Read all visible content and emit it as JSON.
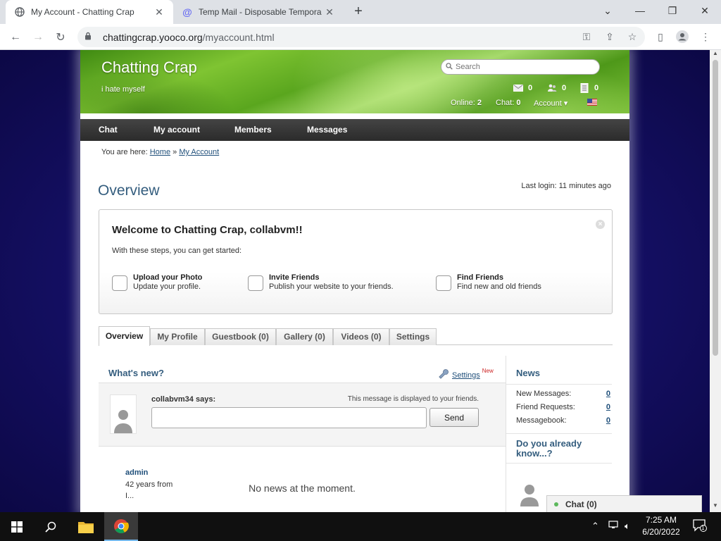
{
  "browser": {
    "tabs": [
      {
        "title": "My Account - Chatting Crap",
        "active": true
      },
      {
        "title": "Temp Mail - Disposable Tempora",
        "active": false
      }
    ],
    "url_host": "chattingcrap.yooco.org",
    "url_path": "/myaccount.html"
  },
  "site": {
    "name": "Chatting Crap",
    "tagline": "i hate myself",
    "search_placeholder": "Search",
    "counters": {
      "messages": "0",
      "friends": "0",
      "guestbook": "0"
    },
    "online_label": "Online:",
    "online_count": "2",
    "chat_label": "Chat:",
    "chat_count": "0",
    "account_menu": "Account ▾"
  },
  "nav": [
    "Chat",
    "My account",
    "Members",
    "Messages"
  ],
  "breadcrumb": {
    "prefix": "You are here:",
    "home": "Home",
    "sep": "»",
    "current": "My Account"
  },
  "overview": {
    "title": "Overview",
    "last_login": "Last login: 11 minutes ago"
  },
  "welcome": {
    "title": "Welcome to Chatting Crap, collabvm!!",
    "subtitle": "With these steps, you can get started:",
    "steps": [
      {
        "title": "Upload your Photo",
        "desc": "Update your profile."
      },
      {
        "title": "Invite Friends",
        "desc": "Publish your website to your friends."
      },
      {
        "title": "Find Friends",
        "desc": "Find new and old friends"
      }
    ]
  },
  "profile_tabs": [
    "Overview",
    "My Profile",
    "Guestbook (0)",
    "Gallery (0)",
    "Videos (0)",
    "Settings"
  ],
  "whats_new": {
    "title": "What's new?",
    "settings_link": "Settings",
    "settings_badge": "New",
    "says": "collabvm34 says:",
    "hint": "This message is displayed to your friends.",
    "send": "Send",
    "empty": "No news at the moment."
  },
  "news": {
    "title": "News",
    "rows": [
      {
        "label": "New Messages:",
        "value": "0"
      },
      {
        "label": "Friend Requests:",
        "value": "0"
      },
      {
        "label": "Messagebook:",
        "value": "0"
      }
    ]
  },
  "know": {
    "title": "Do you already know...?",
    "member_name": "admin",
    "member_age": "42 years from",
    "member_from": "I..."
  },
  "chatbar": {
    "label": "Chat (0)"
  },
  "taskbar": {
    "time": "7:25 AM",
    "date": "6/20/2022",
    "notifications": "1"
  }
}
